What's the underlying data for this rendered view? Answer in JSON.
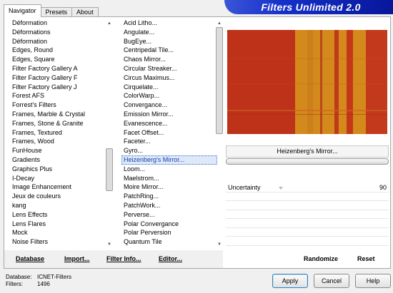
{
  "header": {
    "title": "Filters Unlimited 2.0"
  },
  "tabs": [
    {
      "label": "Navigator"
    },
    {
      "label": "Presets"
    },
    {
      "label": "About"
    }
  ],
  "categories": [
    "Déformation",
    "Déformations",
    "Déformation",
    "Edges, Round",
    "Edges, Square",
    "Filter Factory Gallery A",
    "Filter Factory Gallery F",
    "Filter Factory Gallery J",
    "Forest AFS",
    "Forrest's Filters",
    "Frames, Marble & Crystal",
    "Frames, Stone & Granite",
    "Frames, Textured",
    "Frames, Wood",
    "FunHouse",
    "Gradients",
    "Graphics Plus",
    "I-Decay",
    "Image Enhancement",
    "Jeux de couleurs",
    "kang",
    "Lens Effects",
    "Lens Flares",
    "Mock",
    "Noise Filters"
  ],
  "filters": [
    "Acid Litho...",
    "Angulate...",
    "BugEye...",
    "Centripedal Tile...",
    "Chaos Mirror...",
    "Circular Streaker...",
    "Circus Maximus...",
    "Cirquelate...",
    "ColorWarp...",
    "Convergance...",
    "Emission Mirror...",
    "Evanescence...",
    "Facet Offset...",
    "Faceter...",
    "Gyro...",
    "Heizenberg's Mirror...",
    "Loom...",
    "Maelstrom...",
    "Moire Mirror...",
    "PatchRing...",
    "PatchWork...",
    "Perverse...",
    "Polar Convergance",
    "Polar Perversion",
    "Quantum Tile"
  ],
  "selected_filter": "Heizenberg's Mirror...",
  "list_buttons": {
    "database": "Database",
    "import": "Import...",
    "filter_info": "Filter Info...",
    "editor": "Editor..."
  },
  "parameter": {
    "label": "Uncertainty",
    "value": "90",
    "level": 0.35
  },
  "right_buttons": {
    "randomize": "Randomize",
    "reset": "Reset"
  },
  "status": {
    "database_label": "Database:",
    "database_value": "ICNET-Filters",
    "filters_label": "Filters:",
    "filters_value": "1496"
  },
  "dialog_buttons": {
    "apply": "Apply",
    "cancel": "Cancel",
    "help": "Help"
  },
  "colors": {
    "logo_blue": "#1530c8",
    "preview_red": "#c0341a",
    "preview_orange": "#d4891c",
    "selection": "#dde8f8"
  }
}
